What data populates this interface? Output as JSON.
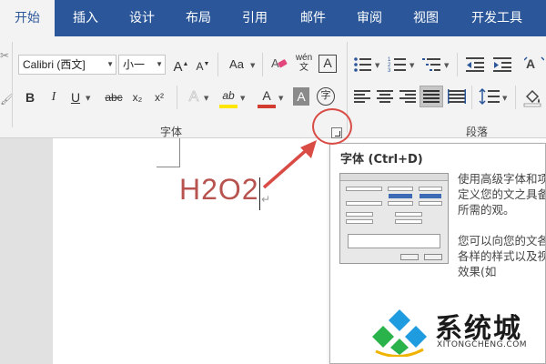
{
  "tabs": [
    {
      "label": "开始",
      "active": true
    },
    {
      "label": "插入"
    },
    {
      "label": "设计"
    },
    {
      "label": "布局"
    },
    {
      "label": "引用"
    },
    {
      "label": "邮件"
    },
    {
      "label": "审阅"
    },
    {
      "label": "视图"
    },
    {
      "label": "开发工具"
    }
  ],
  "font_group": {
    "font_name": "Calibri (西文]",
    "font_size": "小一",
    "grow_label": "A",
    "shrink_label": "A",
    "change_case_label": "Aa",
    "phonetic_top": "wén",
    "phonetic_bottom": "文",
    "border_char_label": "A",
    "bold_label": "B",
    "italic_label": "I",
    "underline_label": "U",
    "strike_label": "abc",
    "subscript_label": "x₂",
    "superscript_label": "x²",
    "text_effects_label": "A",
    "highlight_label": "ab",
    "font_color_label": "A",
    "char_shading_label": "A",
    "enclose_label": "字",
    "label": "字体"
  },
  "paragraph_group": {
    "label": "段落"
  },
  "colors": {
    "tab_bar": "#2b579a",
    "highlight_yellow": "#ffe600",
    "font_red": "#d23b2f",
    "annotation_red": "#d94c45",
    "doc_text": "#b85450"
  },
  "document": {
    "text": "H2O2",
    "para_mark": "↵"
  },
  "tooltip": {
    "title": "字体 (Ctrl+D)",
    "paragraph1": "使用高级字体和项自定义您的文之具备您所需的观。",
    "paragraph2": "您可以向您的文各种各样的样式以及视觉效果(如"
  },
  "watermark": {
    "title": "系统城",
    "subtitle": "XITONGCHENG.COM"
  }
}
